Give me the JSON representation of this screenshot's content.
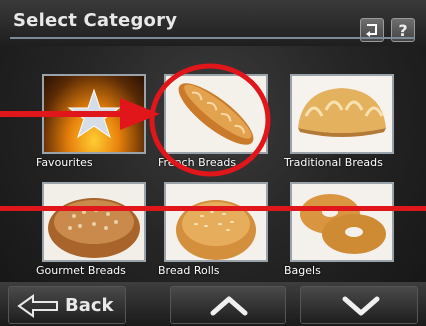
{
  "header": {
    "title": "Select Category",
    "undo_icon": "undo-icon",
    "help_label": "?"
  },
  "categories": [
    {
      "label": "Favourites",
      "icon": "star-icon"
    },
    {
      "label": "French Breads",
      "icon": "french-bread-image"
    },
    {
      "label": "Traditional Breads",
      "icon": "traditional-bread-image"
    },
    {
      "label": "Gourmet Breads",
      "icon": "gourmet-bread-image"
    },
    {
      "label": "Bread Rolls",
      "icon": "bread-roll-image"
    },
    {
      "label": "Bagels",
      "icon": "bagel-image"
    }
  ],
  "footer": {
    "back_label": "Back",
    "up_icon": "chevron-up-icon",
    "down_icon": "chevron-down-icon"
  },
  "colors": {
    "highlight": "#e0161b",
    "rule": "#7a8a98",
    "favourites_orange": "#e8820c"
  }
}
